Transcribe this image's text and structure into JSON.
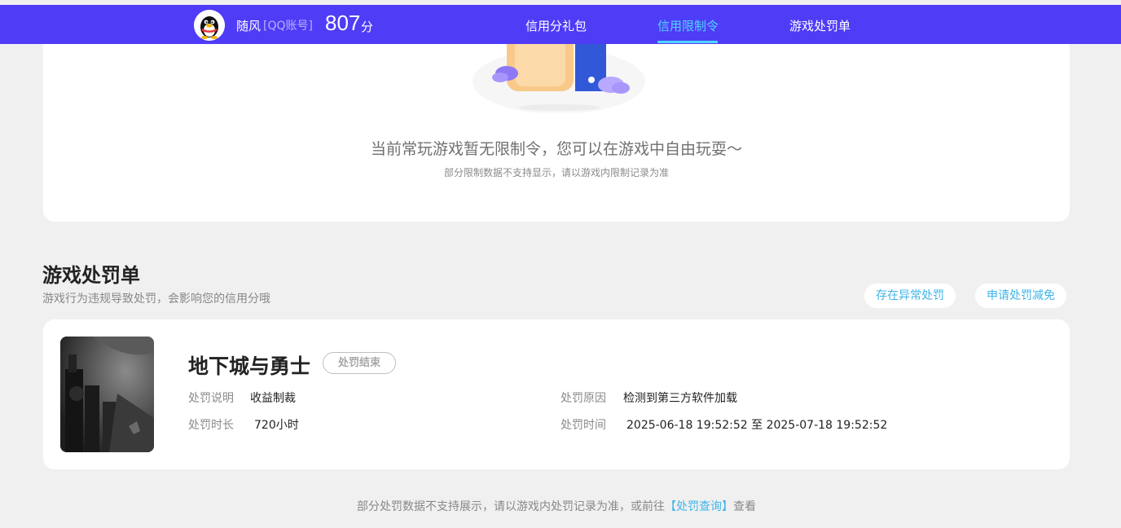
{
  "header": {
    "user_name": "随风",
    "account_type": "[QQ账号]",
    "score": "807",
    "score_unit": "分",
    "tabs": [
      {
        "label": "信用分礼包",
        "active": false
      },
      {
        "label": "信用限制令",
        "active": true
      },
      {
        "label": "游戏处罚单",
        "active": false
      }
    ]
  },
  "restriction": {
    "message": "当前常玩游戏暂无限制令，您可以在游戏中自由玩耍～",
    "note": "部分限制数据不支持显示，请以游戏内限制记录为准"
  },
  "penalty_section": {
    "title": "游戏处罚单",
    "subtitle": "游戏行为违规导致处罚，会影响您的信用分哦",
    "buttons": {
      "abnormal": "存在异常处罚",
      "appeal": "申请处罚减免"
    }
  },
  "penalty_card": {
    "game_name": "地下城与勇士",
    "status": "处罚结束",
    "desc_label": "处罚说明",
    "desc_value": "收益制裁",
    "reason_label": "处罚原因",
    "reason_value": "检测到第三方软件加载",
    "duration_label": "处罚时长",
    "duration_value": "720小时",
    "time_label": "处罚时间",
    "time_value": "2025-06-18 19:52:52 至 2025-07-18 19:52:52"
  },
  "footer": {
    "note_before": "部分处罚数据不支持展示，请以游戏内处罚记录为准，或前往",
    "link": "【处罚查询】",
    "note_after": "查看"
  },
  "colors": {
    "topbar": "#4f3cf7",
    "active_tab": "#4fd5ff",
    "link": "#3fb4e8"
  }
}
